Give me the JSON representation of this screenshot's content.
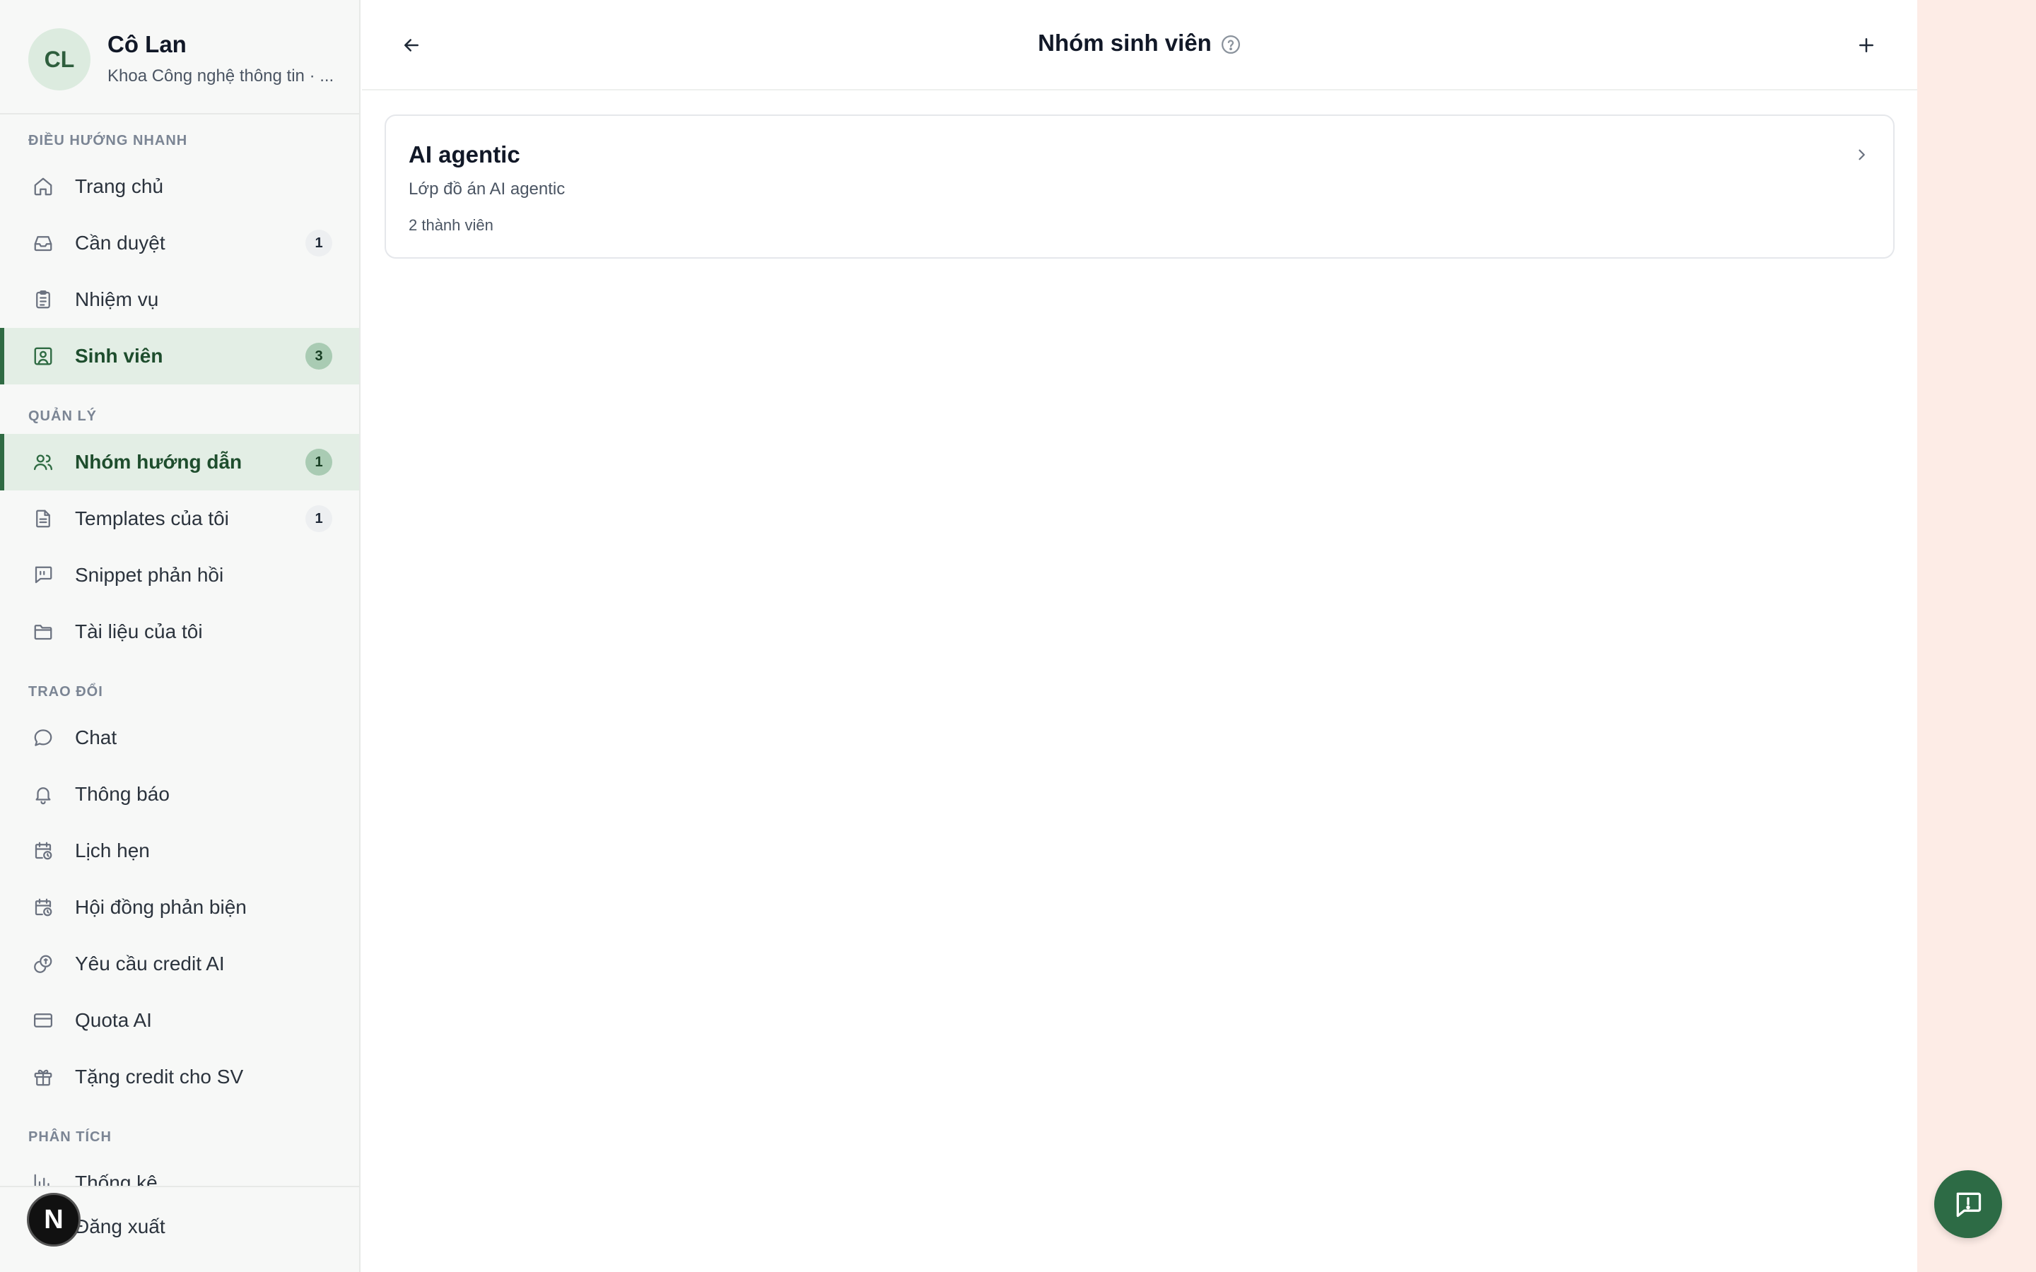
{
  "profile": {
    "initials": "CL",
    "name": "Cô Lan",
    "subtitle": "Khoa Công nghệ thông tin · ..."
  },
  "sections": {
    "quick": "ĐIỀU HƯỚNG NHANH",
    "manage": "QUẢN LÝ",
    "exchange": "TRAO ĐỔI",
    "analytics": "PHÂN TÍCH"
  },
  "nav": {
    "home": {
      "label": "Trang chủ"
    },
    "review": {
      "label": "Cần duyệt",
      "badge": "1"
    },
    "tasks": {
      "label": "Nhiệm vụ"
    },
    "students": {
      "label": "Sinh viên",
      "badge": "3"
    },
    "groups": {
      "label": "Nhóm hướng dẫn",
      "badge": "1"
    },
    "templates": {
      "label": "Templates của tôi",
      "badge": "1"
    },
    "snippets": {
      "label": "Snippet phản hồi"
    },
    "docs": {
      "label": "Tài liệu của tôi"
    },
    "chat": {
      "label": "Chat"
    },
    "notifications": {
      "label": "Thông báo"
    },
    "appointments": {
      "label": "Lịch hẹn"
    },
    "council": {
      "label": "Hội đồng phản biện"
    },
    "credit_request": {
      "label": "Yêu cầu credit AI"
    },
    "quota": {
      "label": "Quota AI"
    },
    "gift_credit": {
      "label": "Tặng credit cho SV"
    },
    "stats": {
      "label": "Thống kê"
    },
    "logout": {
      "label": "Đăng xuất"
    }
  },
  "overlay_badge": "N",
  "header": {
    "title": "Nhóm sinh viên"
  },
  "groups": [
    {
      "name": "AI agentic",
      "description": "Lớp đồ án AI agentic",
      "members": "2 thành viên"
    }
  ],
  "colors": {
    "accent": "#2f6b43",
    "active_bg": "#e3eee5",
    "right_panel": "#fdece6",
    "fab": "#2d6b45"
  }
}
